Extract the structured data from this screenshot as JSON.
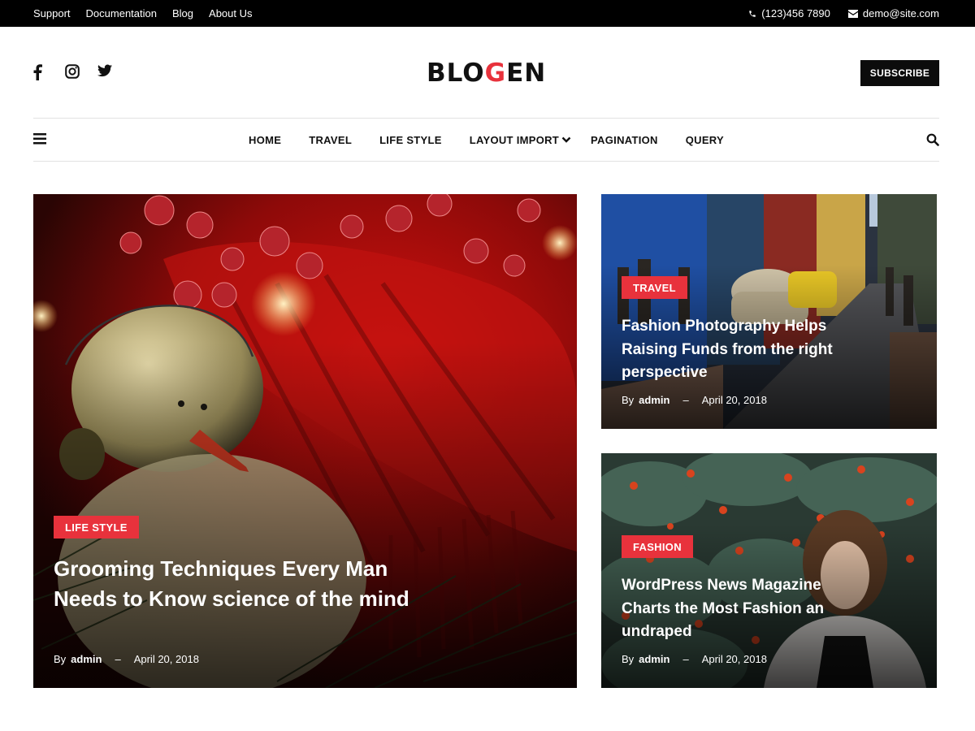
{
  "topbar": {
    "links": [
      "Support",
      "Documentation",
      "Blog",
      "About Us"
    ],
    "phone": "(123)456 7890",
    "email": "demo@site.com"
  },
  "header": {
    "logo_pre": "BLO",
    "logo_accent": "G",
    "logo_post": "EN",
    "subscribe_label": "SUBSCRIBE",
    "social_icons": [
      "facebook-icon",
      "instagram-icon",
      "twitter-icon"
    ]
  },
  "nav": {
    "items": [
      "HOME",
      "TRAVEL",
      "LIFE STYLE",
      "LAYOUT IMPORT",
      "PAGINATION",
      "QUERY"
    ],
    "dropdown_item_index": 3
  },
  "posts": {
    "featured": {
      "category": "LIFE STYLE",
      "title": "Grooming Techniques Every Man Needs to Know science of the mind",
      "by": "By",
      "author": "admin",
      "dash": "–",
      "date": "April 20, 2018"
    },
    "side_top": {
      "category": "TRAVEL",
      "title": "Fashion Photography Helps Raising Funds from the right perspective",
      "by": "By",
      "author": "admin",
      "dash": "–",
      "date": "April 20, 2018"
    },
    "side_bottom": {
      "category": "FASHION",
      "title": "WordPress News Magazine Charts the Most Fashion an undraped",
      "by": "By",
      "author": "admin",
      "dash": "–",
      "date": "April 20, 2018"
    }
  },
  "colors": {
    "accent": "#e8323c",
    "topbar_bg": "#000000",
    "text": "#111111"
  }
}
